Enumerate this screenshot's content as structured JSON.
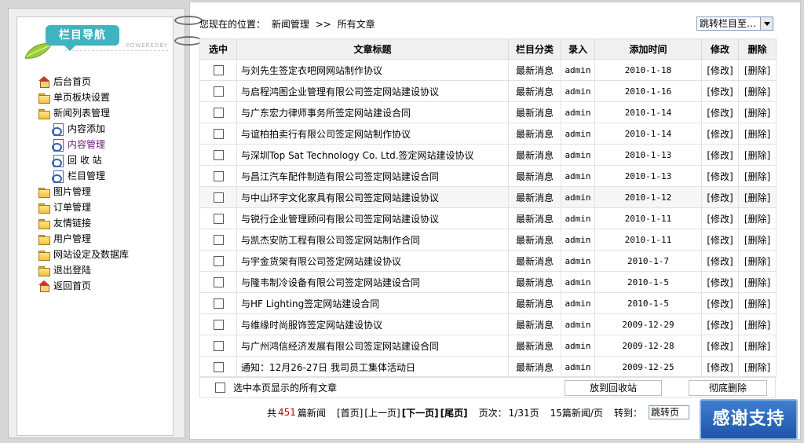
{
  "sidebar": {
    "header_title": "栏目导航",
    "powered": "POWEREDBY",
    "items": [
      {
        "label": "后台首页",
        "icon": "home-icon",
        "level": 0
      },
      {
        "label": "单页板块设置",
        "icon": "folder-icon",
        "level": 0
      },
      {
        "label": "新闻列表管理",
        "icon": "folder-open-icon",
        "level": 0
      },
      {
        "label": "内容添加",
        "icon": "document-icon",
        "level": 1
      },
      {
        "label": "内容管理",
        "icon": "document-icon",
        "level": 1,
        "active": true
      },
      {
        "label": "回 收 站",
        "icon": "document-icon",
        "level": 1
      },
      {
        "label": "栏目管理",
        "icon": "document-icon",
        "level": 1
      },
      {
        "label": "图片管理",
        "icon": "folder-icon",
        "level": 0
      },
      {
        "label": "订单管理",
        "icon": "folder-icon",
        "level": 0
      },
      {
        "label": "友情链接",
        "icon": "folder-icon",
        "level": 0
      },
      {
        "label": "用户管理",
        "icon": "folder-icon",
        "level": 0
      },
      {
        "label": "网站设定及数据库",
        "icon": "folder-icon",
        "level": 0
      },
      {
        "label": "退出登陆",
        "icon": "folder-icon",
        "level": 0
      },
      {
        "label": "返回首页",
        "icon": "home-icon",
        "level": 0
      }
    ]
  },
  "breadcrumb": {
    "prefix": "您现在的位置：",
    "section": "新闻管理",
    "separator": ">>",
    "current": "所有文章"
  },
  "jump_select": {
    "selected": "跳转栏目至…"
  },
  "table": {
    "headers": [
      "选中",
      "文章标题",
      "栏目分类",
      "录入",
      "添加时间",
      "修改",
      "删除"
    ],
    "rows": [
      {
        "title": "与刘先生签定衣吧网网站制作协议",
        "category": "最新消息",
        "author": "admin",
        "date": "2010-1-18",
        "edit": "[修改]",
        "del": "[删除]"
      },
      {
        "title": "与启程鸿图企业管理有限公司签定网站建设协议",
        "category": "最新消息",
        "author": "admin",
        "date": "2010-1-16",
        "edit": "[修改]",
        "del": "[删除]"
      },
      {
        "title": "与广东宏力律师事务所签定网站建设合同",
        "category": "最新消息",
        "author": "admin",
        "date": "2010-1-14",
        "edit": "[修改]",
        "del": "[删除]"
      },
      {
        "title": "与谊柏拍卖行有限公司签定网站制作协议",
        "category": "最新消息",
        "author": "admin",
        "date": "2010-1-14",
        "edit": "[修改]",
        "del": "[删除]"
      },
      {
        "title": "与深圳Top Sat Technology Co. Ltd.签定网站建设协议",
        "category": "最新消息",
        "author": "admin",
        "date": "2010-1-13",
        "edit": "[修改]",
        "del": "[删除]"
      },
      {
        "title": "与昌江汽车配件制造有限公司签定网站建设合同",
        "category": "最新消息",
        "author": "admin",
        "date": "2010-1-13",
        "edit": "[修改]",
        "del": "[删除]"
      },
      {
        "title": "与中山环宇文化家具有限公司签定网站建设协议",
        "category": "最新消息",
        "author": "admin",
        "date": "2010-1-12",
        "edit": "[修改]",
        "del": "[删除]"
      },
      {
        "title": "与锐行企业管理顾问有限公司签定网站建设协议",
        "category": "最新消息",
        "author": "admin",
        "date": "2010-1-11",
        "edit": "[修改]",
        "del": "[删除]"
      },
      {
        "title": "与凯杰安防工程有限公司签定网站制作合同",
        "category": "最新消息",
        "author": "admin",
        "date": "2010-1-11",
        "edit": "[修改]",
        "del": "[删除]"
      },
      {
        "title": "与宇金货架有限公司签定网站建设协议",
        "category": "最新消息",
        "author": "admin",
        "date": "2010-1-7",
        "edit": "[修改]",
        "del": "[删除]"
      },
      {
        "title": "与隆韦制冷设备有限公司签定网站建设合同",
        "category": "最新消息",
        "author": "admin",
        "date": "2010-1-5",
        "edit": "[修改]",
        "del": "[删除]"
      },
      {
        "title": "与HF Lighting签定网站建设合同",
        "category": "最新消息",
        "author": "admin",
        "date": "2010-1-5",
        "edit": "[修改]",
        "del": "[删除]"
      },
      {
        "title": "与维缘时尚服饰签定网站建设协议",
        "category": "最新消息",
        "author": "admin",
        "date": "2009-12-29",
        "edit": "[修改]",
        "del": "[删除]"
      },
      {
        "title": "与广州鸿信经济发展有限公司签定网站建设合同",
        "category": "最新消息",
        "author": "admin",
        "date": "2009-12-28",
        "edit": "[修改]",
        "del": "[删除]"
      },
      {
        "title": "通知：12月26-27日 我司员工集体活动日",
        "category": "最新消息",
        "author": "admin",
        "date": "2009-12-25",
        "edit": "[修改]",
        "del": "[删除]"
      }
    ]
  },
  "bulk": {
    "select_all_label": "选中本页显示的所有文章",
    "recycle_button": "放到回收站",
    "delete_button": "彻底删除"
  },
  "pager": {
    "total_prefix": "共",
    "total_count": "451",
    "total_suffix": "篇新闻",
    "first": "[首页]",
    "prev": "[上一页]",
    "next": "[下一页]",
    "last": "[尾页]",
    "page_label": "页次：",
    "page_value": "1/31页",
    "per_page": "15篇新闻/页",
    "goto_label": "转到：",
    "page_select": "跳转页"
  },
  "overlay": {
    "thanks_label": "感谢支持"
  },
  "colors": {
    "accent": "#3fb3c0",
    "total_count": "#c00000",
    "active_nav": "#6a1f7a",
    "overlay": "#1e55a8"
  }
}
